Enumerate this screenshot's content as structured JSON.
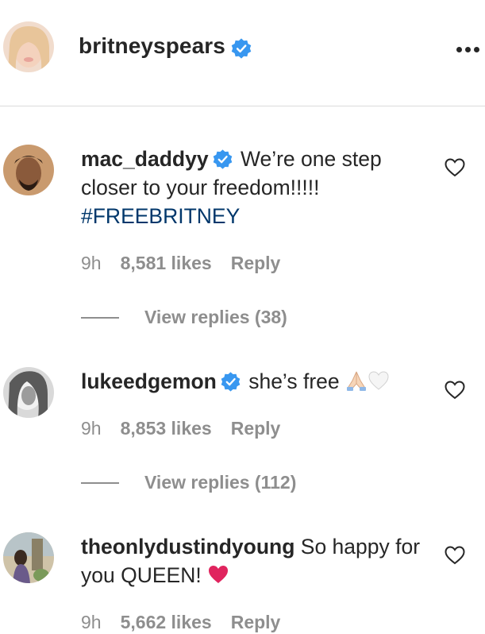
{
  "post": {
    "author": "britneyspears"
  },
  "comments": [
    {
      "username": "mac_daddyy",
      "text_before": "We’re one step closer to your freedom!!!!!",
      "hashtag": "#FREEBRITNEY",
      "time": "9h",
      "likes": "8,581 likes",
      "reply": "Reply",
      "view_replies": "View replies (38)"
    },
    {
      "username": "lukeedgemon",
      "text": "she’s free",
      "time": "9h",
      "likes": "8,853 likes",
      "reply": "Reply",
      "view_replies": "View replies (112)"
    },
    {
      "username": "theonlydustindyoung",
      "text": "So happy for you QUEEN!",
      "time": "9h",
      "likes": "5,662 likes",
      "reply": "Reply"
    }
  ],
  "colors": {
    "verified": "#3897f0",
    "hashtag": "#00376b",
    "muted": "#8e8e8e",
    "heart_emoji": "#e0245e"
  }
}
